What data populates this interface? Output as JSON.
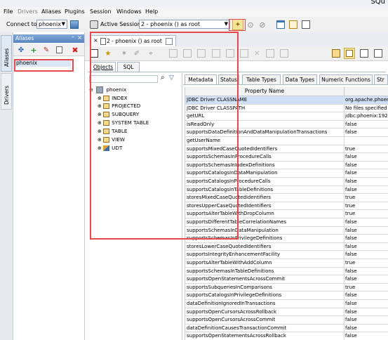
{
  "window_title": "SQu",
  "menu": [
    "File",
    "Drivers",
    "Aliases",
    "Plugins",
    "Session",
    "Windows",
    "Help"
  ],
  "toolbar": {
    "connect_label": "Connect to:",
    "connect_value": "phoenix",
    "session_label": "Active Session:",
    "session_value": "2 - phoenix () as root"
  },
  "left_tabs": {
    "aliases": "Aliases",
    "drivers": "Drivers"
  },
  "aliases_panel": {
    "title": "Aliases",
    "items": [
      "phoenix"
    ]
  },
  "session_tab": {
    "label": "2 - phoenix () as root"
  },
  "sub_tabs": [
    "Objects",
    "SQL"
  ],
  "tree": {
    "root": "phoenix",
    "children": [
      "INDEX",
      "PROJECTED",
      "SUBQUERY",
      "SYSTEM TABLE",
      "TABLE",
      "VIEW",
      "UDT"
    ]
  },
  "meta_tabs": [
    "Metadata",
    "Status",
    "Table Types",
    "Data Types",
    "Numeric Functions",
    "Str"
  ],
  "table": {
    "header": "Property Name",
    "rows": [
      [
        "JDBC Driver CLASSNAME",
        "org.apache.phoen"
      ],
      [
        "JDBC Driver CLASSPATH",
        "No files specified"
      ],
      [
        "getURL",
        "jdbc:phoenix:192."
      ],
      [
        "isReadOnly",
        "false"
      ],
      [
        "supportsDataDefinitionAndDataManipulationTransactions",
        "false"
      ],
      [
        "getUserName",
        ""
      ],
      [
        "supportsMixedCaseQuotedIdentifiers",
        "true"
      ],
      [
        "supportsSchemasInProcedureCalls",
        "false"
      ],
      [
        "supportsSchemasInIndexDefinitions",
        "false"
      ],
      [
        "supportsCatalogsInDataManipulation",
        "false"
      ],
      [
        "supportsCatalogsInProcedureCalls",
        "false"
      ],
      [
        "supportsCatalogsInTableDefinitions",
        "false"
      ],
      [
        "storesMixedCaseQuotedIdentifiers",
        "true"
      ],
      [
        "storesUpperCaseQuotedIdentifiers",
        "true"
      ],
      [
        "supportsAlterTableWithDropColumn",
        "true"
      ],
      [
        "supportsDifferentTableCorrelationNames",
        "false"
      ],
      [
        "supportsSchemasInDataManipulation",
        "false"
      ],
      [
        "supportsSchemasInPrivilegeDefinitions",
        "false"
      ],
      [
        "storesLowerCaseQuotedIdentifiers",
        "false"
      ],
      [
        "supportsIntegrityEnhancementFacility",
        "false"
      ],
      [
        "supportsAlterTableWithAddColumn",
        "true"
      ],
      [
        "supportsSchemasInTableDefinitions",
        "false"
      ],
      [
        "supportsOpenStatementsAcrossCommit",
        "false"
      ],
      [
        "supportsSubqueriesInComparisons",
        "true"
      ],
      [
        "supportsCatalogsInPrivilegeDefinitions",
        "false"
      ],
      [
        "dataDefinitionIgnoredInTransactions",
        "false"
      ],
      [
        "supportsOpenCursorsAcrossRollback",
        "false"
      ],
      [
        "supportsOpenCursorsAcrossCommit",
        "false"
      ],
      [
        "dataDefinitionCausesTransactionCommit",
        "false"
      ],
      [
        "supportsOpenStatementsAcrossRollback",
        "false"
      ]
    ]
  }
}
